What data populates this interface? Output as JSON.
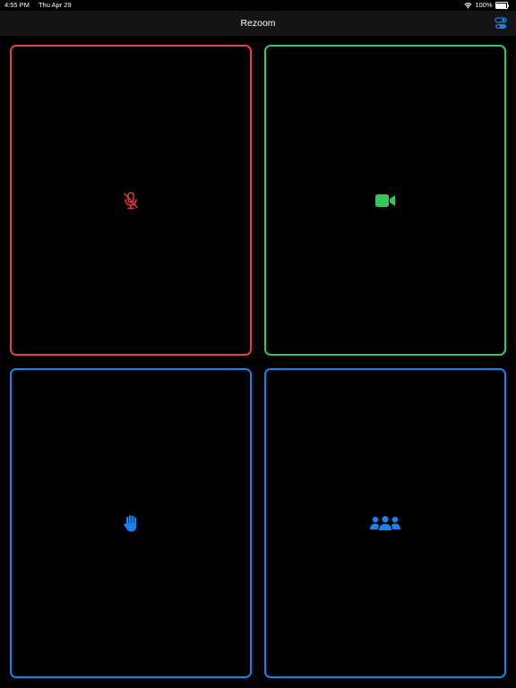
{
  "status_bar": {
    "time": "4:55 PM",
    "date": "Thu Apr 29",
    "battery_percent": "100%",
    "wifi_icon": "wifi-icon",
    "battery_icon": "battery-full-icon"
  },
  "nav": {
    "title": "Rezoom",
    "settings_icon": "toggle-switches-icon"
  },
  "colors": {
    "mute_red": "#E5443A",
    "video_green": "#34C759",
    "action_blue": "#1A82F0",
    "background": "#000000",
    "nav_background": "#141414"
  },
  "tiles": [
    {
      "icon": "mic-slash-icon",
      "color": "#E5443A"
    },
    {
      "icon": "video-camera-icon",
      "color": "#34C759"
    },
    {
      "icon": "raised-hand-icon",
      "color": "#1A82F0"
    },
    {
      "icon": "participants-icon",
      "color": "#1A82F0"
    }
  ]
}
